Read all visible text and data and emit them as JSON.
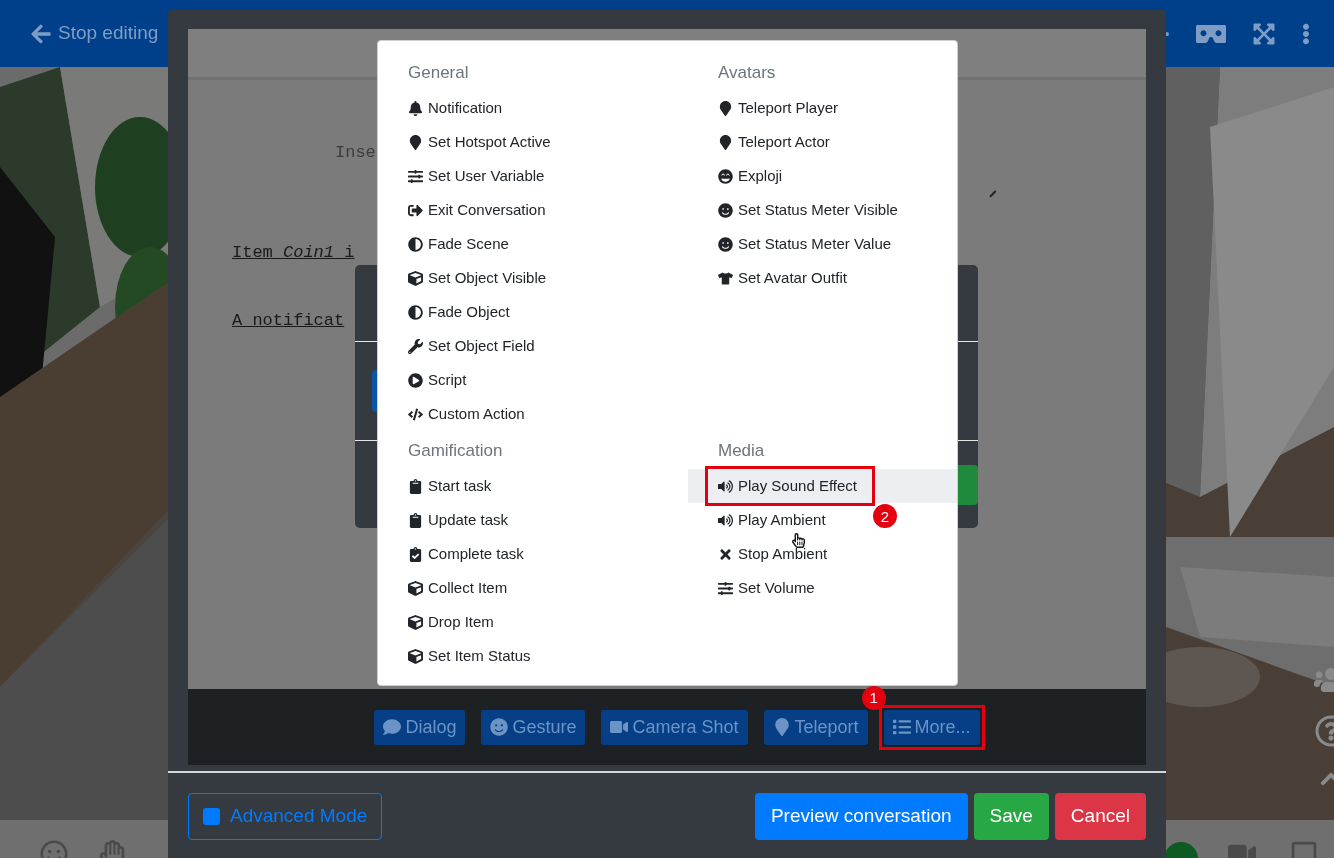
{
  "top_bar": {
    "back_label": "Stop editing"
  },
  "editor": {
    "hint": "Inse",
    "lines": [
      "Item *Coin1* i",
      "A notificat"
    ]
  },
  "menu": {
    "sections": [
      {
        "title": "General",
        "items": [
          {
            "label": "Notification",
            "kind": "bell",
            "selected": false
          },
          {
            "label": "Set Hotspot Active",
            "kind": "pin",
            "selected": false
          },
          {
            "label": "Set User Variable",
            "kind": "sliders",
            "selected": false
          },
          {
            "label": "Exit Conversation",
            "kind": "exit",
            "selected": false
          },
          {
            "label": "Fade Scene",
            "kind": "contrast",
            "selected": false
          },
          {
            "label": "Set Object Visible",
            "kind": "cube",
            "selected": false
          },
          {
            "label": "Fade Object",
            "kind": "contrast",
            "selected": false
          },
          {
            "label": "Set Object Field",
            "kind": "wrench",
            "selected": false
          },
          {
            "label": "Script",
            "kind": "play",
            "selected": false
          },
          {
            "label": "Custom Action",
            "kind": "code",
            "selected": false
          }
        ]
      },
      {
        "title": "Avatars",
        "items": [
          {
            "label": "Teleport Player",
            "kind": "pin",
            "selected": false
          },
          {
            "label": "Teleport Actor",
            "kind": "pin",
            "selected": false
          },
          {
            "label": "Exploji",
            "kind": "grin",
            "selected": false
          },
          {
            "label": "Set Status Meter Visible",
            "kind": "smile",
            "selected": false
          },
          {
            "label": "Set Status Meter Value",
            "kind": "smile",
            "selected": false
          },
          {
            "label": "Set Avatar Outfit",
            "kind": "shirt",
            "selected": false
          }
        ]
      },
      {
        "title": "Gamification",
        "items": [
          {
            "label": "Start task",
            "kind": "clipboard",
            "selected": false
          },
          {
            "label": "Update task",
            "kind": "clipboard",
            "selected": false
          },
          {
            "label": "Complete task",
            "kind": "clipboardcheck",
            "selected": false
          },
          {
            "label": "Collect Item",
            "kind": "cube",
            "selected": false
          },
          {
            "label": "Drop Item",
            "kind": "cube",
            "selected": false
          },
          {
            "label": "Set Item Status",
            "kind": "cube",
            "selected": false
          }
        ]
      },
      {
        "title": "Media",
        "items": [
          {
            "label": "Play Sound Effect",
            "kind": "speaker",
            "selected": true,
            "callout": "2"
          },
          {
            "label": "Play Ambient",
            "kind": "speaker",
            "selected": false
          },
          {
            "label": "Stop Ambient",
            "kind": "cross",
            "selected": false
          },
          {
            "label": "Set Volume",
            "kind": "sliders",
            "selected": false
          }
        ]
      }
    ]
  },
  "toolbar": {
    "buttons": [
      {
        "label": "Dialog",
        "kind": "comment"
      },
      {
        "label": "Gesture",
        "kind": "smile"
      },
      {
        "label": "Camera Shot",
        "kind": "video"
      },
      {
        "label": "Teleport",
        "kind": "pin"
      },
      {
        "label": "More...",
        "kind": "list",
        "callout": "1"
      }
    ]
  },
  "footer": {
    "advanced_mode": {
      "label": "Advanced Mode"
    },
    "buttons": [
      {
        "label": "Preview conversation",
        "kind": "primary"
      },
      {
        "label": "Save",
        "kind": "success"
      },
      {
        "label": "Cancel",
        "kind": "danger"
      }
    ]
  }
}
